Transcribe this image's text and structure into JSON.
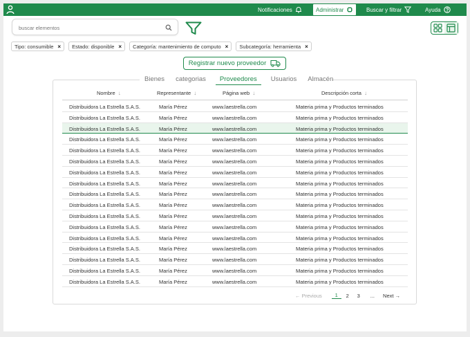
{
  "topbar": {
    "notifications": "Notificaciones",
    "admin": "Administrar",
    "search_filter": "Buscar y filtrar",
    "help": "Ayuda"
  },
  "search": {
    "placeholder": "buscar elementos"
  },
  "chips": [
    {
      "label": "Tipo: consumible"
    },
    {
      "label": "Estado: disponible"
    },
    {
      "label": "Categoría: mantenimiento de computo"
    },
    {
      "label": "Subcategoría: herramienta"
    }
  ],
  "chip_remove": "×",
  "register_label": "Registrar nuevo proveedor",
  "tabs": [
    {
      "label": "Bienes"
    },
    {
      "label": "categorias"
    },
    {
      "label": "Proveedores",
      "active": true
    },
    {
      "label": "Usuarios"
    },
    {
      "label": "Almacén"
    }
  ],
  "table": {
    "headers": [
      "Nombre",
      "Representante",
      "Página web",
      "Descripción corta"
    ],
    "sort_arrow": "↓",
    "selected_row": 2,
    "rows": [
      [
        "Distribuidora La Estrella S.A.S.",
        "María Pérez",
        "www.laestrella.com",
        "Materia prima y Productos terminados"
      ],
      [
        "Distribuidora La Estrella S.A.S.",
        "María Pérez",
        "www.laestrella.com",
        "Materia prima y Productos terminados"
      ],
      [
        "Distribuidora La Estrella S.A.S.",
        "María Pérez",
        "www.laestrella.com",
        "Materia prima y Productos terminados"
      ],
      [
        "Distribuidora La Estrella S.A.S.",
        "María Pérez",
        "www.laestrella.com",
        "Materia prima y Productos terminados"
      ],
      [
        "Distribuidora La Estrella S.A.S.",
        "María Pérez",
        "www.laestrella.com",
        "Materia prima y Productos terminados"
      ],
      [
        "Distribuidora La Estrella S.A.S.",
        "María Pérez",
        "www.laestrella.com",
        "Materia prima y Productos terminados"
      ],
      [
        "Distribuidora La Estrella S.A.S.",
        "María Pérez",
        "www.laestrella.com",
        "Materia prima y Productos terminados"
      ],
      [
        "Distribuidora La Estrella S.A.S.",
        "María Pérez",
        "www.laestrella.com",
        "Materia prima y Productos terminados"
      ],
      [
        "Distribuidora La Estrella S.A.S.",
        "María Pérez",
        "www.laestrella.com",
        "Materia prima y Productos terminados"
      ],
      [
        "Distribuidora La Estrella S.A.S.",
        "María Pérez",
        "www.laestrella.com",
        "Materia prima y Productos terminados"
      ],
      [
        "Distribuidora La Estrella S.A.S.",
        "María Pérez",
        "www.laestrella.com",
        "Materia prima y Productos terminados"
      ],
      [
        "Distribuidora La Estrella S.A.S.",
        "María Pérez",
        "www.laestrella.com",
        "Materia prima y Productos terminados"
      ],
      [
        "Distribuidora La Estrella S.A.S.",
        "María Pérez",
        "www.laestrella.com",
        "Materia prima y Productos terminados"
      ],
      [
        "Distribuidora La Estrella S.A.S.",
        "María Pérez",
        "www.laestrella.com",
        "Materia prima y Productos terminados"
      ],
      [
        "Distribuidora La Estrella S.A.S.",
        "María Pérez",
        "www.laestrella.com",
        "Materia prima y Productos terminados"
      ],
      [
        "Distribuidora La Estrella S.A.S.",
        "María Pérez",
        "www.laestrella.com",
        "Materia prima y Productos terminados"
      ],
      [
        "Distribuidora La Estrella S.A.S.",
        "María Pérez",
        "www.laestrella.com",
        "Materia prima y Productos terminados"
      ]
    ]
  },
  "pagination": {
    "prev": "← Previous",
    "pages": [
      "1",
      "2",
      "3"
    ],
    "current": "1",
    "ellipsis": "...",
    "next": "Next →"
  },
  "colors": {
    "brand": "#1f8a4c",
    "selected_row": "#e9f5ec"
  }
}
